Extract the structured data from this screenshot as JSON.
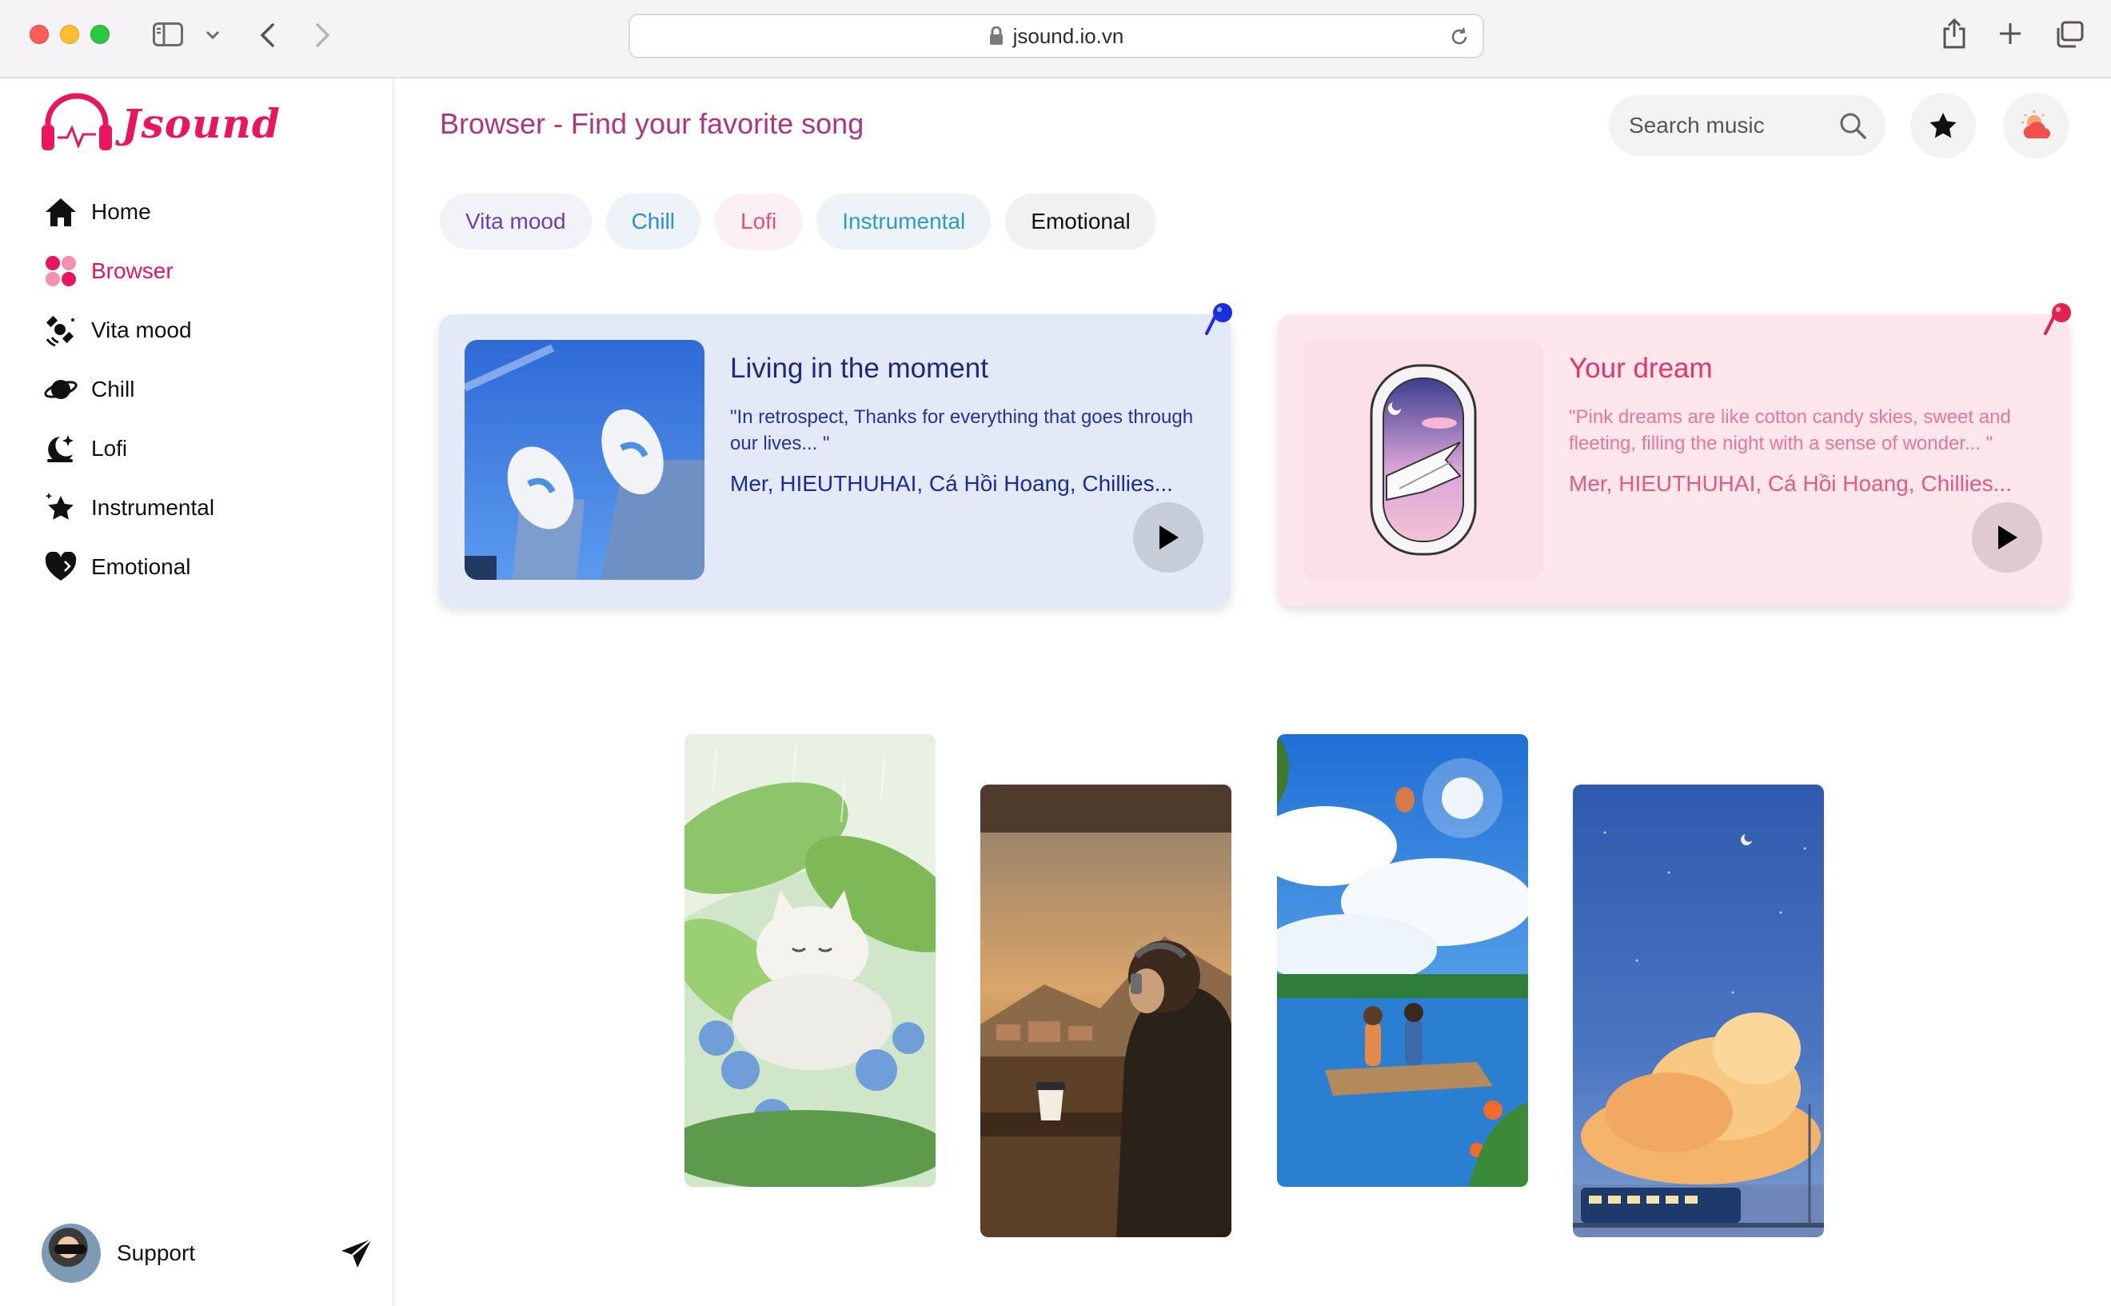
{
  "browser": {
    "url": "jsound.io.vn"
  },
  "app": {
    "logo_text": "Jsound"
  },
  "sidebar": {
    "items": [
      {
        "label": "Home",
        "icon": "home-icon"
      },
      {
        "label": "Browser",
        "icon": "grid-icon",
        "active": true
      },
      {
        "label": "Vita mood",
        "icon": "satellite-icon"
      },
      {
        "label": "Chill",
        "icon": "planet-icon"
      },
      {
        "label": "Lofi",
        "icon": "moon-icon"
      },
      {
        "label": "Instrumental",
        "icon": "star-icon"
      },
      {
        "label": "Emotional",
        "icon": "heart-icon"
      }
    ],
    "support_label": "Support"
  },
  "header": {
    "title": "Browser - Find your favorite song",
    "search_placeholder": "Search music"
  },
  "tags": [
    "Vita mood",
    "Chill",
    "Lofi",
    "Instrumental",
    "Emotional"
  ],
  "playlists": [
    {
      "title": "Living in the moment",
      "quote": "\"In retrospect, Thanks for everything that goes through our lives... \"",
      "artists": "Mer, HIEUTHUHAI, Cá Hồi Hoang, Chillies..."
    },
    {
      "title": "Your dream",
      "quote": "\"Pink dreams are like cotton candy skies, sweet and fleeting, filling the night with a sense of wonder... \"",
      "artists": "Mer, HIEUTHUHAI, Cá Hồi Hoang, Chillies..."
    }
  ],
  "colors": {
    "brand": "#e8175d",
    "title": "#b0357f",
    "card_blue": "#e3e9f7",
    "card_pink": "#fde6ec"
  }
}
